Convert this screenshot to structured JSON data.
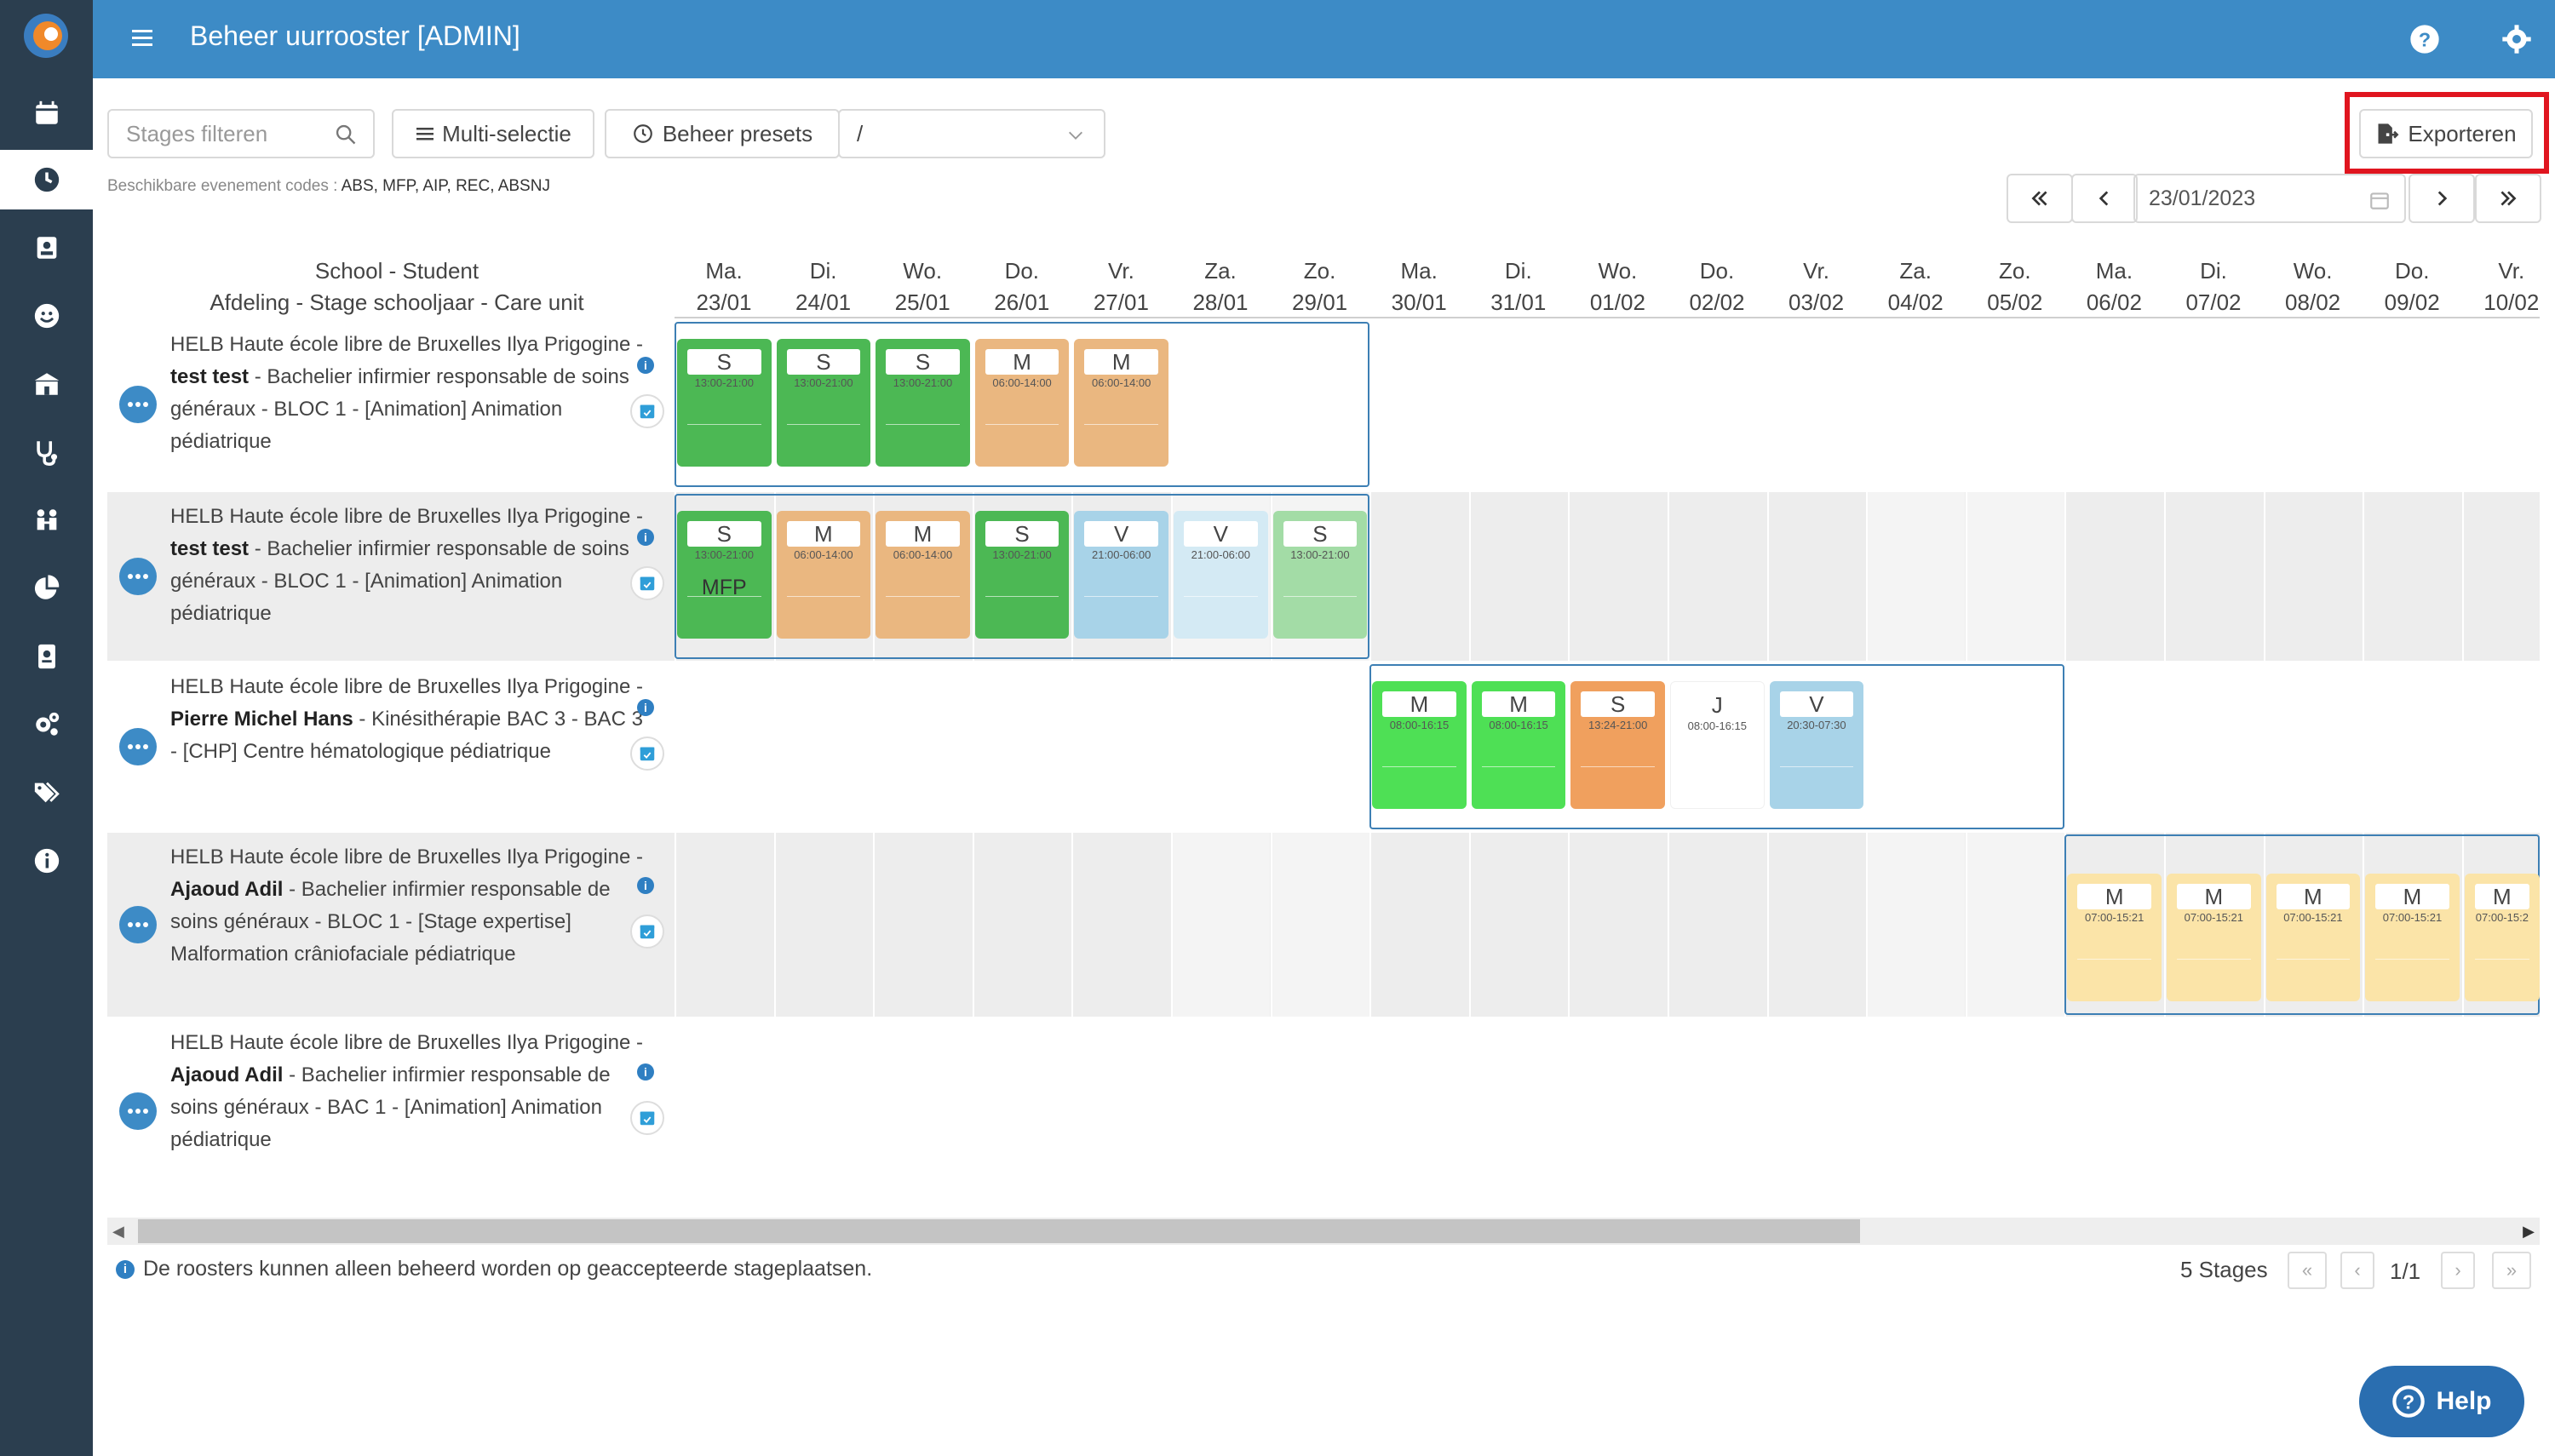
{
  "app": {
    "title": "Beheer uurrooster [ADMIN]"
  },
  "sidebar": {
    "items": [
      {
        "icon": "calendar-icon"
      },
      {
        "icon": "clock-icon",
        "active": true
      },
      {
        "icon": "student-icon"
      },
      {
        "icon": "smiley-icon"
      },
      {
        "icon": "school-icon"
      },
      {
        "icon": "stethoscope-icon"
      },
      {
        "icon": "people-icon"
      },
      {
        "icon": "pie-chart-icon"
      },
      {
        "icon": "contact-card-icon"
      },
      {
        "icon": "settings-icon"
      },
      {
        "icon": "tags-icon"
      },
      {
        "icon": "info-icon"
      }
    ]
  },
  "toolbar": {
    "filter_placeholder": "Stages filteren",
    "multi_label": "Multi-selectie",
    "presets_label": "Beheer presets",
    "select_value": "/",
    "export_label": "Exporteren"
  },
  "codes": {
    "prefix": "Beschikbare evenement codes : ",
    "list": "ABS, MFP, AIP, REC, ABSNJ"
  },
  "datenav": {
    "date": "23/01/2023"
  },
  "header": {
    "line1": "School - Student",
    "line2": "Afdeling - Stage schooljaar - Care unit"
  },
  "days": [
    {
      "dow": "Ma.",
      "date": "23/01"
    },
    {
      "dow": "Di.",
      "date": "24/01"
    },
    {
      "dow": "Wo.",
      "date": "25/01"
    },
    {
      "dow": "Do.",
      "date": "26/01"
    },
    {
      "dow": "Vr.",
      "date": "27/01"
    },
    {
      "dow": "Za.",
      "date": "28/01"
    },
    {
      "dow": "Zo.",
      "date": "29/01"
    },
    {
      "dow": "Ma.",
      "date": "30/01"
    },
    {
      "dow": "Di.",
      "date": "31/01"
    },
    {
      "dow": "Wo.",
      "date": "01/02"
    },
    {
      "dow": "Do.",
      "date": "02/02"
    },
    {
      "dow": "Vr.",
      "date": "03/02"
    },
    {
      "dow": "Za.",
      "date": "04/02"
    },
    {
      "dow": "Zo.",
      "date": "05/02"
    },
    {
      "dow": "Ma.",
      "date": "06/02"
    },
    {
      "dow": "Di.",
      "date": "07/02"
    },
    {
      "dow": "Wo.",
      "date": "08/02"
    },
    {
      "dow": "Do.",
      "date": "09/02"
    },
    {
      "dow": "Vr.",
      "date": "10/02"
    }
  ],
  "rows": [
    {
      "school": "HELB Haute école libre de Bruxelles Ilya Prigogine",
      "student": "test test",
      "rest": "Bachelier infirmier responsable de soins généraux - BLOC 1 - [Animation] Animation pédiatrique",
      "cells": [
        {
          "day": 0,
          "code": "S",
          "time": "13:00-21:00",
          "color": "#4cb854"
        },
        {
          "day": 1,
          "code": "S",
          "time": "13:00-21:00",
          "color": "#4cb854"
        },
        {
          "day": 2,
          "code": "S",
          "time": "13:00-21:00",
          "color": "#4cb854"
        },
        {
          "day": 3,
          "code": "M",
          "time": "06:00-14:00",
          "color": "#eab780"
        },
        {
          "day": 4,
          "code": "M",
          "time": "06:00-14:00",
          "color": "#eab780"
        }
      ]
    },
    {
      "school": "HELB Haute école libre de Bruxelles Ilya Prigogine",
      "student": "test test",
      "rest": "Bachelier infirmier responsable de soins généraux - BLOC 1 - [Animation] Animation pédiatrique",
      "cells": [
        {
          "day": 0,
          "code": "S",
          "time": "13:00-21:00",
          "color": "#4cb854",
          "sub": "MFP"
        },
        {
          "day": 1,
          "code": "M",
          "time": "06:00-14:00",
          "color": "#eab780"
        },
        {
          "day": 2,
          "code": "M",
          "time": "06:00-14:00",
          "color": "#eab780"
        },
        {
          "day": 3,
          "code": "S",
          "time": "13:00-21:00",
          "color": "#4cb854"
        },
        {
          "day": 4,
          "code": "V",
          "time": "21:00-06:00",
          "color": "#a8d3e8"
        },
        {
          "day": 5,
          "code": "V",
          "time": "21:00-06:00",
          "color": "#d4eaf4"
        },
        {
          "day": 6,
          "code": "S",
          "time": "13:00-21:00",
          "color": "#a3dca6"
        }
      ]
    },
    {
      "school": "HELB Haute école libre de Bruxelles Ilya Prigogine",
      "student": "Pierre Michel Hans",
      "rest": "Kinésithérapie BAC 3 - BAC 3 - [CHP] Centre hématologique pédiatrique",
      "cells": [
        {
          "day": 7,
          "code": "M",
          "time": "08:00-16:15",
          "color": "#4ee055"
        },
        {
          "day": 8,
          "code": "M",
          "time": "08:00-16:15",
          "color": "#4ee055"
        },
        {
          "day": 9,
          "code": "S",
          "time": "13:24-21:00",
          "color": "#f0a05e"
        },
        {
          "day": 10,
          "code": "J",
          "time": "08:00-16:15",
          "color": "#ffffff"
        },
        {
          "day": 11,
          "code": "V",
          "time": "20:30-07:30",
          "color": "#a8d3e8"
        }
      ]
    },
    {
      "school": "HELB Haute école libre de Bruxelles Ilya Prigogine",
      "student": "Ajaoud Adil",
      "rest": "Bachelier infirmier responsable de soins généraux - BLOC 1 - [Stage expertise] Malformation crâniofaciale pédiatrique",
      "cells": [
        {
          "day": 14,
          "code": "M",
          "time": "07:00-15:21",
          "color": "#fbe4a8"
        },
        {
          "day": 15,
          "code": "M",
          "time": "07:00-15:21",
          "color": "#fbe4a8"
        },
        {
          "day": 16,
          "code": "M",
          "time": "07:00-15:21",
          "color": "#fbe4a8"
        },
        {
          "day": 17,
          "code": "M",
          "time": "07:00-15:21",
          "color": "#fbe4a8"
        },
        {
          "day": 18,
          "code": "M",
          "time": "07:00-15:2",
          "color": "#fbe4a8"
        }
      ]
    },
    {
      "school": "HELB Haute école libre de Bruxelles Ilya Prigogine",
      "student": "Ajaoud Adil",
      "rest": "Bachelier infirmier responsable de soins généraux - BAC 1 - [Animation] Animation pédiatrique",
      "cells": []
    }
  ],
  "footer": {
    "note": "De roosters kunnen alleen beheerd worden op geaccepteerde stageplaatsen.",
    "count": "5 Stages",
    "page": "1/1"
  },
  "help": {
    "label": "Help"
  }
}
